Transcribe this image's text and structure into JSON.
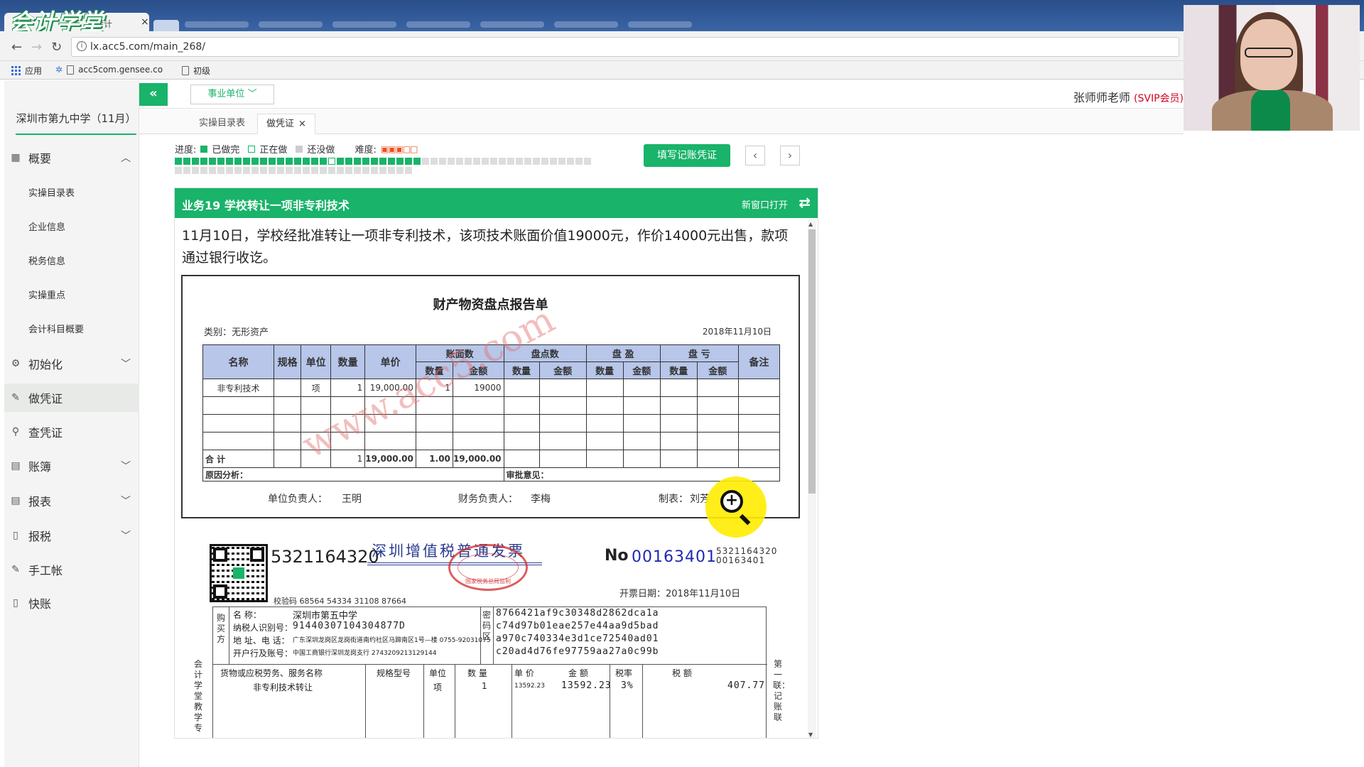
{
  "browser": {
    "logo_text": "会计学堂",
    "tab_title": "会计",
    "url": "lx.acc5.com/main_268/",
    "bookmarks": [
      "应用",
      "acc5com.gensee.co",
      "初级"
    ]
  },
  "app": {
    "company": "深圳市第九中学（11月）",
    "unit_select": "事业单位",
    "teacher": "张师师老师",
    "member_badge": "(SVIP会员)",
    "tabs": [
      {
        "label": "实操目录表",
        "active": false
      },
      {
        "label": "做凭证",
        "active": true
      }
    ],
    "sidebar": {
      "overview": "概要",
      "overview_sub": [
        "实操目录表",
        "企业信息",
        "税务信息",
        "实操重点",
        "会计科目概要"
      ],
      "items": [
        {
          "label": "初始化",
          "expandable": true
        },
        {
          "label": "做凭证",
          "expandable": false,
          "active": true
        },
        {
          "label": "查凭证",
          "expandable": false
        },
        {
          "label": "账簿",
          "expandable": true
        },
        {
          "label": "报表",
          "expandable": true
        },
        {
          "label": "报税",
          "expandable": true
        },
        {
          "label": "手工帐",
          "expandable": false
        },
        {
          "label": "快账",
          "expandable": false
        }
      ]
    },
    "progress": {
      "label": "进度:",
      "legend_done": "已做完",
      "legend_doing": "正在做",
      "legend_todo": "还没做",
      "difficulty_label": "难度:",
      "difficulty_stars": 3,
      "difficulty_max": 5,
      "total_tasks": 77,
      "done_tasks": 29,
      "current_task": 19
    },
    "fill_button": "填写记账凭证",
    "task": {
      "title": "业务19 学校转让一项非专利技术",
      "new_window": "新窗口打开",
      "description": "11月10日，学校经批准转让一项非专利技术，该项技术账面价值19000元，作价14000元出售，款项通过银行收讫。"
    }
  },
  "report": {
    "title": "财产物资盘点报告单",
    "category": "类别：无形资产",
    "date": "2018年11月10日",
    "headers": {
      "name": "名称",
      "spec": "规格",
      "unit": "单位",
      "qty": "数量",
      "price": "单价",
      "book": "账面数",
      "count": "盘点数",
      "surplus": "盘 盈",
      "loss": "盘 亏",
      "note": "备注",
      "sub_qty": "数量",
      "sub_amount": "金额"
    },
    "row": {
      "name": "非专利技术",
      "unit": "项",
      "qty": "1",
      "price": "19,000.00",
      "book_qty": "1",
      "book_amount": "19000"
    },
    "total": {
      "label": "合  计",
      "qty": "1",
      "price": "19,000.00",
      "book_qty": "1.00",
      "book_amount": "19,000.00"
    },
    "reason_label": "原因分析：",
    "approval_label": "审批意见：",
    "signatures": {
      "unit_head_label": "单位负责人：",
      "unit_head": "王明",
      "finance_head_label": "财务负责人：",
      "finance_head": "李梅",
      "prepared_label": "制表：",
      "prepared": "刘芳"
    },
    "watermark_1": "www.acc5.com"
  },
  "invoice": {
    "code": "5321164320",
    "title": "深圳增值税普通发票",
    "seal_text": "国家税务总局监制",
    "no_label": "No",
    "number": "00163401",
    "side_code": "5321164320",
    "side_number": "00163401",
    "date": "开票日期：2018年11月10日",
    "check_code": "校验码 68564 54334 31108 87664",
    "buyer_section": "购买方",
    "buyer_name_label": "名        称：",
    "buyer_name": "深圳市第五中学",
    "buyer_taxid_label": "纳税人识别号：",
    "buyer_taxid": "91440307104304877D",
    "buyer_addr_label": "地  址、电  话：",
    "buyer_addr": "广东深圳龙岗区龙岗街道南约社区马蹄南区1号—楼 0755-92031075",
    "buyer_bank_label": "开户行及账号：",
    "buyer_bank": "中国工商银行深圳龙岗支行 2743209213129144",
    "cipher_section": "密码区",
    "cipher": [
      "8766421af9c30348d2862dca1a",
      "c74d97b01eae257e44aa9d5bad",
      "a970c740334e3d1ce72540ad01",
      "c20ad4d76fe97759aa27a0c99b"
    ],
    "columns": [
      "货物或应税劳务、服务名称",
      "规格型号",
      "单位",
      "数  量",
      "单  价",
      "金   额",
      "税率",
      "税   额"
    ],
    "item": {
      "name": "非专利技术转让",
      "unit": "项",
      "qty": "1",
      "price": "13592.23",
      "amount": "13592.23",
      "rate": "3%",
      "tax": "407.77"
    },
    "left_vertical": "会计学堂教学专",
    "right_vertical": "第一联：记账联"
  }
}
